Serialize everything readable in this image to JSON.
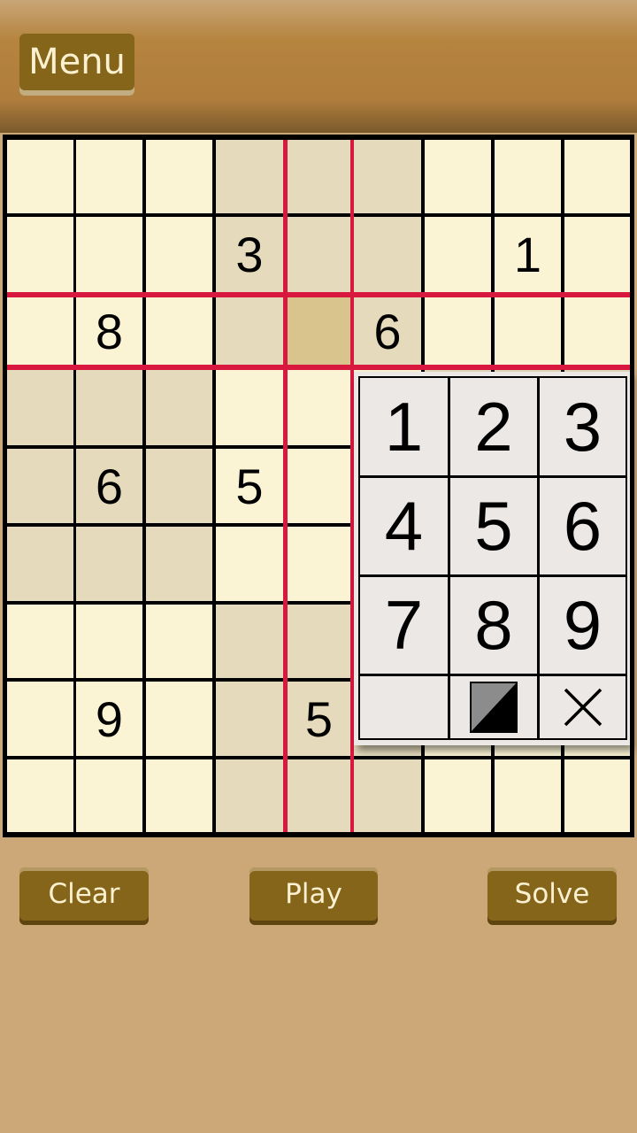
{
  "header": {
    "menu_label": "Menu"
  },
  "board": {
    "givens": [
      [
        "",
        "",
        "",
        "",
        "",
        "",
        "",
        "",
        ""
      ],
      [
        "",
        "",
        "",
        "3",
        "",
        "",
        "",
        "1",
        ""
      ],
      [
        "",
        "8",
        "",
        "",
        "",
        "6",
        "",
        "",
        ""
      ],
      [
        "",
        "",
        "",
        "",
        "",
        "",
        "",
        "",
        ""
      ],
      [
        "",
        "6",
        "",
        "5",
        "",
        "",
        "",
        "",
        ""
      ],
      [
        "",
        "",
        "",
        "",
        "",
        "",
        "",
        "",
        ""
      ],
      [
        "",
        "",
        "",
        "",
        "",
        "",
        "",
        "",
        ""
      ],
      [
        "",
        "9",
        "",
        "",
        "5",
        "",
        "",
        "",
        ""
      ],
      [
        "",
        "",
        "",
        "",
        "",
        "",
        "",
        "",
        ""
      ]
    ],
    "selected_cell": {
      "row": 3,
      "col": 5
    },
    "colors": {
      "light": "#fbf4d4",
      "shaded": "#e5dabb",
      "selected": "#d8c48c",
      "highlight_line": "#d8183e"
    }
  },
  "number_pad": {
    "keys": [
      "1",
      "2",
      "3",
      "4",
      "5",
      "6",
      "7",
      "8",
      "9"
    ],
    "bottom_row": [
      "blank",
      "toggle-shade-icon",
      "close-icon"
    ]
  },
  "footer": {
    "clear_label": "Clear",
    "play_label": "Play",
    "solve_label": "Solve"
  }
}
